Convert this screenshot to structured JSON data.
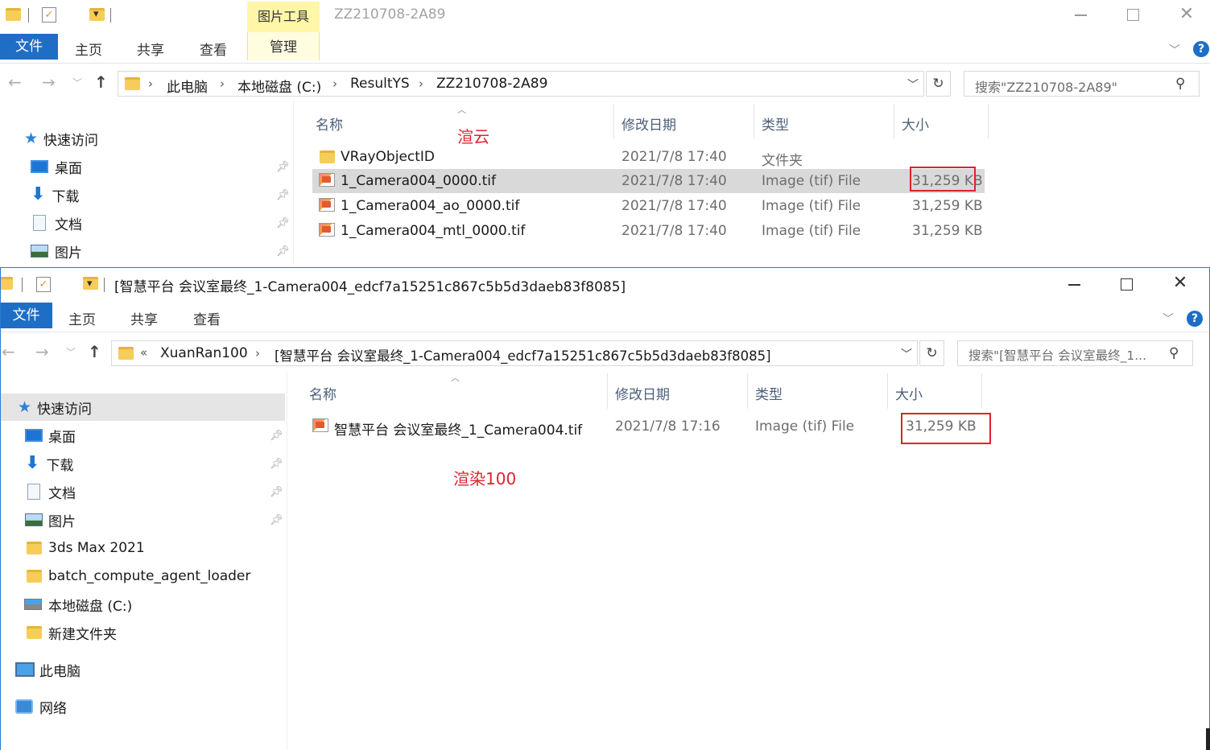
{
  "window1": {
    "title": "ZZ210708-2A89",
    "context_tab_header": "图片工具",
    "ribbon": {
      "file_tab": "文件",
      "tabs": [
        "主页",
        "共享",
        "查看"
      ],
      "context_tab": "管理"
    },
    "address": {
      "crumbs": [
        "此电脑",
        "本地磁盘 (C:)",
        "ResultYS",
        "ZZ210708-2A89"
      ],
      "search_placeholder": "搜索\"ZZ210708-2A89\""
    },
    "nav": {
      "quick_access": "快速访问",
      "items": [
        "桌面",
        "下载",
        "文档",
        "图片"
      ]
    },
    "columns": {
      "name": "名称",
      "modified": "修改日期",
      "type": "类型",
      "size": "大小"
    },
    "files": [
      {
        "name": "VRayObjectID",
        "modified": "2021/7/8 17:40",
        "type": "文件夹",
        "size": ""
      },
      {
        "name": "1_Camera004_0000.tif",
        "modified": "2021/7/8 17:40",
        "type": "Image (tif) File",
        "size": "31,259 KB"
      },
      {
        "name": "1_Camera004_ao_0000.tif",
        "modified": "2021/7/8 17:40",
        "type": "Image (tif) File",
        "size": "31,259 KB"
      },
      {
        "name": "1_Camera004_mtl_0000.tif",
        "modified": "2021/7/8 17:40",
        "type": "Image (tif) File",
        "size": "31,259 KB"
      }
    ],
    "annotation": "渲云"
  },
  "window2": {
    "title": "[智慧平台 会议室最终_1-Camera004_edcf7a15251c867c5b5d3daeb83f8085]",
    "ribbon": {
      "file_tab": "文件",
      "tabs": [
        "主页",
        "共享",
        "查看"
      ]
    },
    "address": {
      "overflow": "«",
      "crumbs": [
        "XuanRan100",
        "[智慧平台 会议室最终_1-Camera004_edcf7a15251c867c5b5d3daeb83f8085]"
      ],
      "search_placeholder": "搜索\"[智慧平台 会议室最终_1..."
    },
    "nav": {
      "quick_access": "快速访问",
      "pinned": [
        "桌面",
        "下载",
        "文档",
        "图片"
      ],
      "folders": [
        "3ds Max 2021",
        "batch_compute_agent_loader"
      ],
      "drive": "本地磁盘 (C:)",
      "new_folder": "新建文件夹",
      "this_pc": "此电脑",
      "network": "网络"
    },
    "columns": {
      "name": "名称",
      "modified": "修改日期",
      "type": "类型",
      "size": "大小"
    },
    "files": [
      {
        "name": "智慧平台 会议室最终_1_Camera004.tif",
        "modified": "2021/7/8 17:16",
        "type": "Image (tif) File",
        "size": "31,259 KB"
      }
    ],
    "annotation": "渲染100"
  },
  "colors": {
    "accent_blue": "#1e6ec5",
    "annotation_red": "#e0212e",
    "context_tab_yellow": "#fff6a8"
  }
}
